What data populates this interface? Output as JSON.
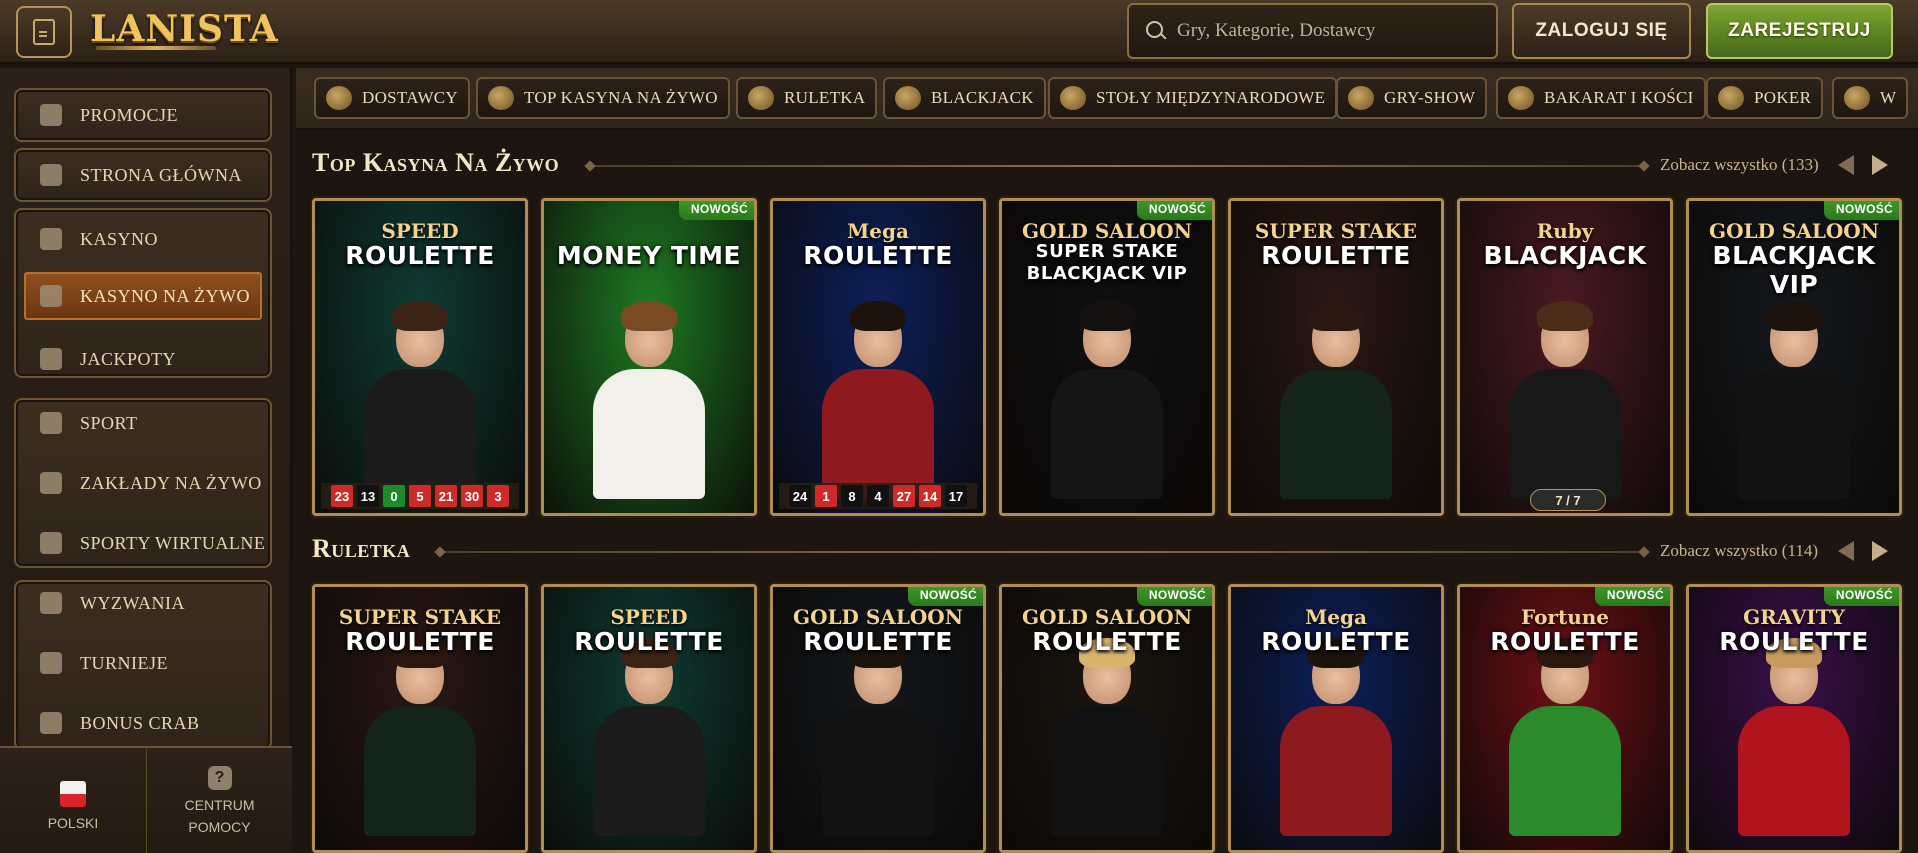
{
  "header": {
    "logo_text": "LANISTA",
    "search_placeholder": "Gry, Kategorie, Dostawcy",
    "login_label": "ZALOGUJ SIĘ",
    "register_label": "ZAREJESTRUJ"
  },
  "sidebar": {
    "items": [
      {
        "label": "PROMOCJE",
        "icon": "gift-icon"
      },
      {
        "label": "STRONA GŁÓWNA",
        "icon": "helmet-icon"
      },
      {
        "label": "KASYNO",
        "icon": "casino-icon"
      },
      {
        "label": "KASYNO NA ŻYWO",
        "icon": "live-casino-icon",
        "active": true
      },
      {
        "label": "JACKPOTY",
        "icon": "clover-icon"
      },
      {
        "label": "SPORT",
        "icon": "soccer-ball-icon"
      },
      {
        "label": "ZAKŁADY NA ŻYWO",
        "icon": "live-bet-icon"
      },
      {
        "label": "SPORTY WIRTUALNE",
        "icon": "virtual-sports-icon"
      },
      {
        "label": "WYZWANIA",
        "icon": "medal-icon"
      },
      {
        "label": "TURNIEJE",
        "icon": "podium-icon"
      },
      {
        "label": "BONUS CRAB",
        "icon": "crab-icon"
      }
    ],
    "language_label": "POLSKI",
    "help_label_line1": "CENTRUM",
    "help_label_line2": "POMOCY"
  },
  "categories": [
    {
      "label": "DOSTAWCY",
      "icon": "scroll-icon"
    },
    {
      "label": "TOP KASYNA NA ŻYWO",
      "icon": "gem-icon"
    },
    {
      "label": "RULETKA",
      "icon": "roulette-icon"
    },
    {
      "label": "BLACKJACK",
      "icon": "cards-icon"
    },
    {
      "label": "STOŁY MIĘDZYNARODOWE",
      "icon": "globe-icon"
    },
    {
      "label": "GRY-SHOW",
      "icon": "microphone-icon"
    },
    {
      "label": "BAKARAT I KOŚCI",
      "icon": "dice-icon"
    },
    {
      "label": "POKER",
      "icon": "chips-icon"
    },
    {
      "label": "W",
      "icon": "wheel-icon"
    }
  ],
  "sections": [
    {
      "title": "Top Kasyna Na Żywo",
      "see_all": "Zobacz wszystko (133)",
      "cards": [
        {
          "sub": "SPEED",
          "title": "ROULETTE",
          "new": false,
          "bg": "#0f3b33",
          "body": "#1b1b1b",
          "hair": "#3b2416",
          "numbers": [
            [
              "23",
              "red"
            ],
            [
              "13",
              "black"
            ],
            [
              "0",
              "green"
            ],
            [
              "5",
              "red"
            ],
            [
              "21",
              "red"
            ],
            [
              "30",
              "red"
            ],
            [
              "3",
              "red"
            ]
          ]
        },
        {
          "sub": "",
          "title": "MONEY TIME",
          "new": true,
          "bg": "#1e7a23",
          "body": "#f2f0ea",
          "hair": "#7a4a22"
        },
        {
          "sub": "Mega",
          "title": "ROULETTE",
          "new": false,
          "bg": "#0d1f5a",
          "body": "#8e1a1f",
          "hair": "#1c130d",
          "numbers": [
            [
              "24",
              "black"
            ],
            [
              "1",
              "red"
            ],
            [
              "8",
              "black"
            ],
            [
              "4",
              "black"
            ],
            [
              "27",
              "red"
            ],
            [
              "14",
              "red"
            ],
            [
              "17",
              "black"
            ]
          ]
        },
        {
          "sub": "GOLD SALOON",
          "title": "SUPER STAKE BLACKJACK VIP",
          "new": true,
          "bg": "#0f0f10",
          "body": "#151515",
          "hair": "#151010"
        },
        {
          "sub": "SUPER STAKE",
          "title": "ROULETTE",
          "new": false,
          "bg": "#2a1814",
          "body": "#14241a",
          "hair": "#2a170f"
        },
        {
          "sub": "Ruby",
          "title": "BLACKJACK",
          "new": false,
          "bg": "#4a1a22",
          "body": "#181818",
          "hair": "#4a2c18",
          "seats": "7 / 7"
        },
        {
          "sub": "GOLD SALOON",
          "title": "BLACKJACK VIP",
          "new": true,
          "bg": "#15181c",
          "body": "#121212",
          "hair": "#1c130d"
        }
      ]
    },
    {
      "title": "Ruletka",
      "see_all": "Zobacz wszystko (114)",
      "cards": [
        {
          "sub": "SUPER STAKE",
          "title": "ROULETTE",
          "new": false,
          "bg": "#2a1814",
          "body": "#14241a",
          "hair": "#2a170f"
        },
        {
          "sub": "SPEED",
          "title": "ROULETTE",
          "new": false,
          "bg": "#0f3b33",
          "body": "#1b1b1b",
          "hair": "#3b2416"
        },
        {
          "sub": "GOLD SALOON",
          "title": "ROULETTE",
          "new": true,
          "bg": "#13171c",
          "body": "#121212",
          "hair": "#1c130d"
        },
        {
          "sub": "GOLD SALOON",
          "title": "ROULETTE",
          "new": true,
          "bg": "#1a1510",
          "body": "#111111",
          "hair": "#d8b56c"
        },
        {
          "sub": "Mega",
          "title": "ROULETTE",
          "new": false,
          "bg": "#0d1f5a",
          "body": "#8e1a1f",
          "hair": "#1c130d"
        },
        {
          "sub": "Fortune",
          "title": "ROULETTE",
          "new": true,
          "bg": "#6e1016",
          "body": "#2b8a2a",
          "hair": "#2a170f"
        },
        {
          "sub": "GRAVITY",
          "title": "ROULETTE",
          "new": true,
          "bg": "#3a0f4a",
          "body": "#b0141c",
          "hair": "#c99a60"
        }
      ]
    }
  ],
  "colors": {
    "accent_gold": "#b08d52",
    "register_green": "#5a8120",
    "active_orange": "#8f4f1e"
  }
}
